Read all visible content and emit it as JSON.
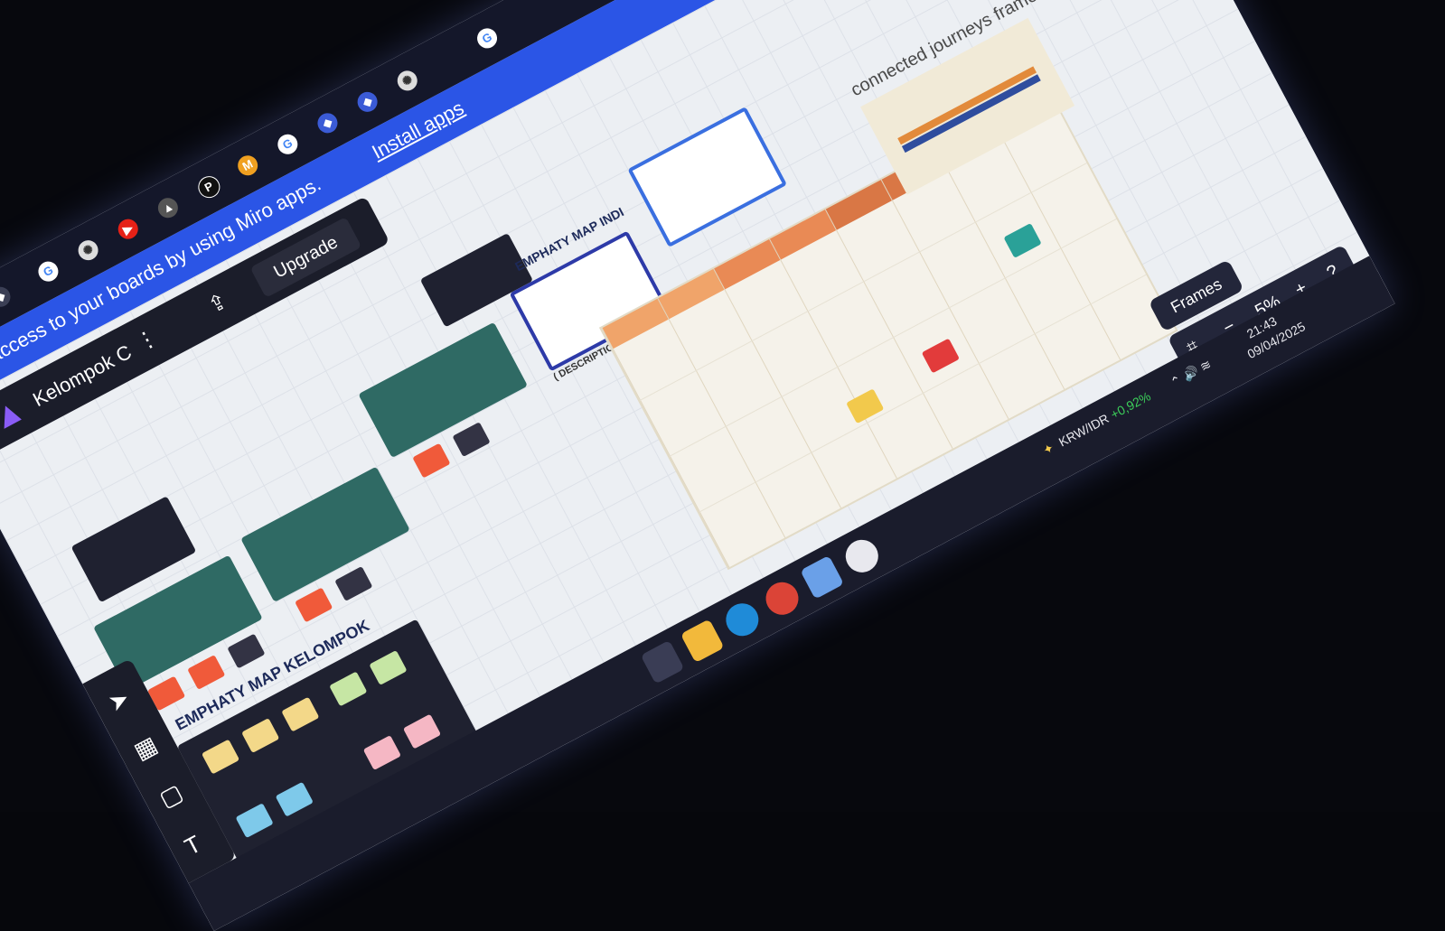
{
  "banner": {
    "message": "access to your boards by using Miro apps.",
    "install_link": "Install apps"
  },
  "board": {
    "name": "Kelompok C",
    "upgrade_label": "Upgrade",
    "more_icon": "more-vertical-icon",
    "share_icon": "share-upload-icon"
  },
  "canvas": {
    "emphaty_individual_title": "EMPHATY MAP INDI",
    "emphaty_group_title": "EMPHATY MAP KELOMPOK",
    "journey_description": "( DESCRIPTION OF THE JOURNEY )",
    "connected_label": "connected journeys framework"
  },
  "controls": {
    "frames_label": "Frames",
    "zoom_level": "5%",
    "zoom_out": "−",
    "zoom_in": "+",
    "help": "?"
  },
  "taskbar": {
    "ticker": "KRW/IDR",
    "ticker_change": "+0,92%",
    "time": "21:43",
    "date": "09/04/2025"
  },
  "colors": {
    "banner": "#2b55e6",
    "toolbar": "#1b1d2a",
    "ticker_positive": "#3ccf5a"
  }
}
